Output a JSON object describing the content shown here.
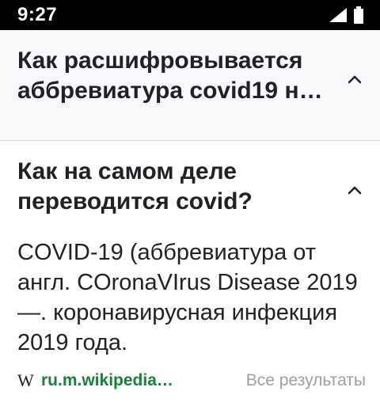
{
  "status_bar": {
    "time": "9:27"
  },
  "faq": {
    "items": [
      {
        "question": "Как расшифровывается аббревиатура covid19 н…",
        "expanded": false
      },
      {
        "question": "Как на самом деле переводится covid?",
        "expanded": true,
        "answer": "COVID-19 (аббревиатура от англ. COronaVIrus Disease 2019 —. коронавирусная инфекция 2019 года.",
        "source_icon_text": "W",
        "source_link": "ru.m.wikipedia…",
        "all_results_label": "Все результаты"
      }
    ]
  },
  "icons": {
    "status": [
      "signal-icon",
      "battery-icon"
    ],
    "toggle_expanded": "chevron-up-icon"
  },
  "colors": {
    "status_bar_bg": "#000000",
    "collapsed_card_bg": "#f8f9fa",
    "link_green": "#188038",
    "muted_text": "#9aa0a6"
  }
}
